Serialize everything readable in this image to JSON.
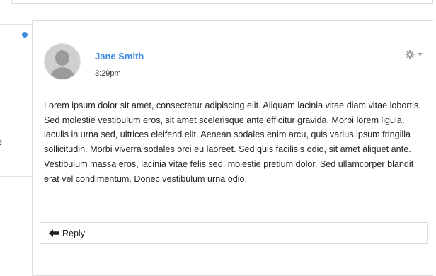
{
  "background_card": {
    "partial_text": "e"
  },
  "post": {
    "author": "Jane Smith",
    "time": "3:29pm",
    "body": "Lorem ipsum dolor sit amet, consectetur adipiscing elit. Aliquam lacinia vitae diam vitae lobortis. Sed molestie vestibulum eros, sit amet scelerisque ante efficitur gravida. Morbi lorem ligula, iaculis in urna sed, ultrices eleifend elit. Aenean sodales enim arcu, quis varius ipsum fringilla sollicitudin. Morbi viverra sodales orci eu laoreet. Sed quis facilisis odio, sit amet aliquet ante. Vestibulum massa eros, lacinia vitae felis sed, molestie pretium dolor. Sed ullamcorper blandit erat vel condimentum. Donec vestibulum urna odio.",
    "unread": true,
    "avatar_icon": "default-user-silhouette-icon",
    "menu_icon": "gear-icon"
  },
  "reply": {
    "label": "Reply",
    "icon": "arrow-left-icon"
  },
  "colors": {
    "accent": "#3d8ee0",
    "border": "#dcdcdc",
    "icon_gray": "#a0a0a0"
  }
}
